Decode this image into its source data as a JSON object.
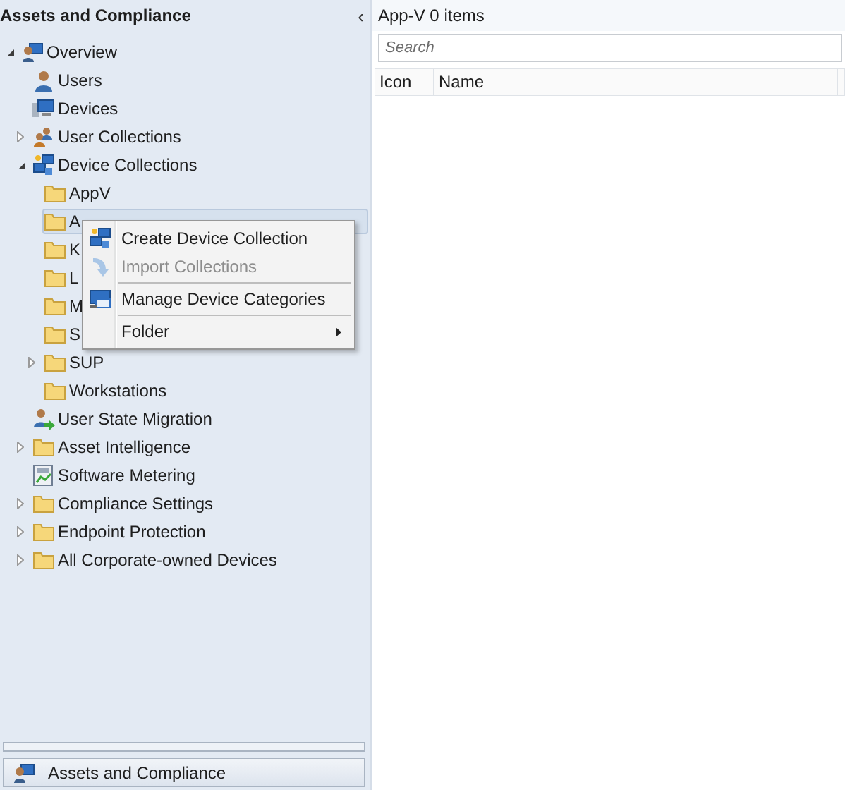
{
  "navigation": {
    "title": "Assets and Compliance",
    "collapse_glyph": "‹",
    "tree": [
      {
        "label": "Overview",
        "kind": "overview",
        "expanded": true,
        "selected": false,
        "children": [
          {
            "label": "Users",
            "kind": "user",
            "selected": false
          },
          {
            "label": "Devices",
            "kind": "device",
            "selected": false
          },
          {
            "label": "User Collections",
            "kind": "user-collections",
            "expanded": false,
            "selected": false
          },
          {
            "label": "Device Collections",
            "kind": "device-collections",
            "expanded": true,
            "selected": false,
            "children": [
              {
                "label": "AppV",
                "kind": "folder",
                "selected": false
              },
              {
                "label": "A",
                "kind": "folder",
                "selected": true
              },
              {
                "label": "K",
                "kind": "folder",
                "selected": false
              },
              {
                "label": "L",
                "kind": "folder",
                "selected": false
              },
              {
                "label": "M",
                "kind": "folder",
                "selected": false
              },
              {
                "label": "S",
                "kind": "folder",
                "selected": false
              },
              {
                "label": "SUP",
                "kind": "folder",
                "expanded": false,
                "selected": false
              },
              {
                "label": "Workstations",
                "kind": "folder",
                "selected": false
              }
            ]
          },
          {
            "label": "User State Migration",
            "kind": "migration",
            "selected": false
          },
          {
            "label": "Asset Intelligence",
            "kind": "folder",
            "expanded": false,
            "selected": false
          },
          {
            "label": "Software Metering",
            "kind": "metering",
            "selected": false
          },
          {
            "label": "Compliance Settings",
            "kind": "folder",
            "expanded": false,
            "selected": false
          },
          {
            "label": "Endpoint Protection",
            "kind": "folder",
            "expanded": false,
            "selected": false
          },
          {
            "label": "All Corporate-owned Devices",
            "kind": "folder",
            "expanded": false,
            "selected": false
          }
        ]
      }
    ],
    "workspace_button": {
      "label": "Assets and Compliance"
    }
  },
  "context_menu": [
    {
      "kind": "create",
      "label": "Create Device Collection",
      "disabled": false
    },
    {
      "kind": "import",
      "label": "Import Collections",
      "disabled": true
    },
    {
      "kind": "separator"
    },
    {
      "kind": "categories",
      "label": "Manage Device Categories",
      "disabled": false
    },
    {
      "kind": "separator"
    },
    {
      "kind": "submenu",
      "label": "Folder",
      "disabled": false
    }
  ],
  "content": {
    "title": "App-V 0 items",
    "search": {
      "placeholder": "Search"
    },
    "columns": [
      "Icon",
      "Name"
    ]
  }
}
